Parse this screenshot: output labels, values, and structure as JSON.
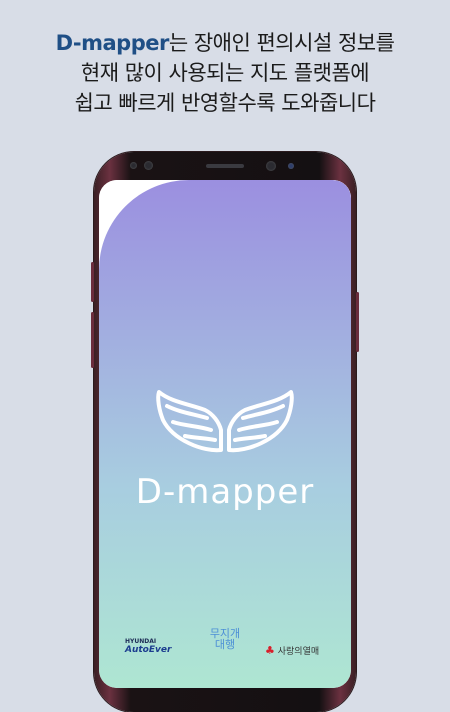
{
  "headline": {
    "brand": "D-mapper",
    "line1_rest": "는 장애인 편의시설 정보를",
    "line2": "현재 많이 사용되는 지도 플랫폼에",
    "line3": "쉽고 빠르게 반영할수록 도와줍니다"
  },
  "app": {
    "name": "D-mapper",
    "logo_icon": "wings-icon",
    "colors": {
      "gradient_top": "#9b8fe0",
      "gradient_bottom": "#aee6d2",
      "brand_text": "#1f4f86"
    }
  },
  "sponsors": {
    "hyundai_top": "HYUNDAI",
    "hyundai_bottom": "AutoEver",
    "middle": "무지개 대행",
    "right": "사랑의열매"
  }
}
